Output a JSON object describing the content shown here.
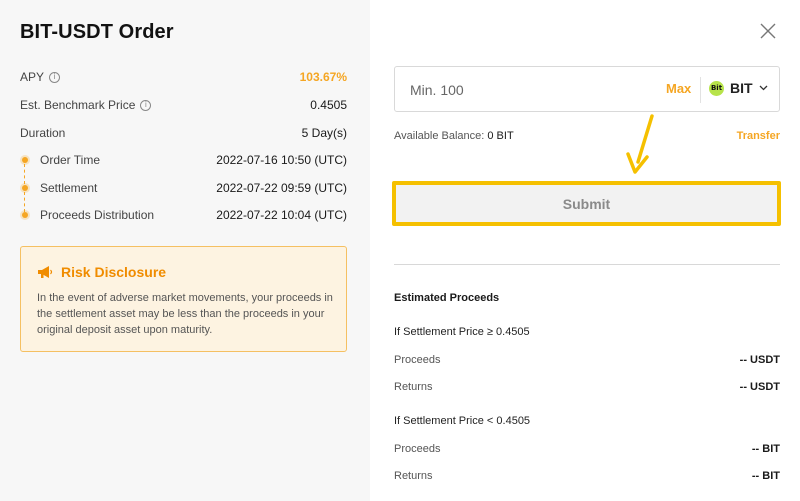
{
  "order": {
    "title": "BIT-USDT Order",
    "apy": {
      "label": "APY",
      "value": "103.67%"
    },
    "benchmark": {
      "label": "Est. Benchmark Price",
      "value": "0.4505"
    },
    "duration": {
      "label": "Duration",
      "value": "5 Day(s)"
    },
    "timeline": [
      {
        "label": "Order Time",
        "value": "2022-07-16 10:50 (UTC)"
      },
      {
        "label": "Settlement",
        "value": "2022-07-22 09:59 (UTC)"
      },
      {
        "label": "Proceeds Distribution",
        "value": "2022-07-22 10:04 (UTC)"
      }
    ],
    "info_icon": "info-icon"
  },
  "risk": {
    "title": "Risk Disclosure",
    "icon": "megaphone-icon",
    "text": "In the event of adverse market movements, your proceeds in the settlement asset may be less than the proceeds in your original deposit asset upon maturity."
  },
  "form": {
    "close_icon": "close-icon",
    "amount_placeholder": "Min. 100",
    "amount_value": "",
    "max_label": "Max",
    "token": {
      "symbol": "BIT",
      "logo_text": "Bit"
    },
    "balance_label": "Available Balance:",
    "balance_value": "0 BIT",
    "transfer_label": "Transfer",
    "submit_label": "Submit"
  },
  "estimate": {
    "title": "Estimated Proceeds",
    "above": {
      "condition": "If Settlement Price ≥ 0.4505",
      "proceeds_label": "Proceeds",
      "proceeds_value": "-- USDT",
      "returns_label": "Returns",
      "returns_value": "-- USDT"
    },
    "below": {
      "condition": "If Settlement Price < 0.4505",
      "proceeds_label": "Proceeds",
      "proceeds_value": "-- BIT",
      "returns_label": "Returns",
      "returns_value": "-- BIT"
    }
  },
  "colors": {
    "accent": "#f5a623",
    "highlight_border": "#f5c000",
    "risk_bg": "#fdf3e1"
  }
}
